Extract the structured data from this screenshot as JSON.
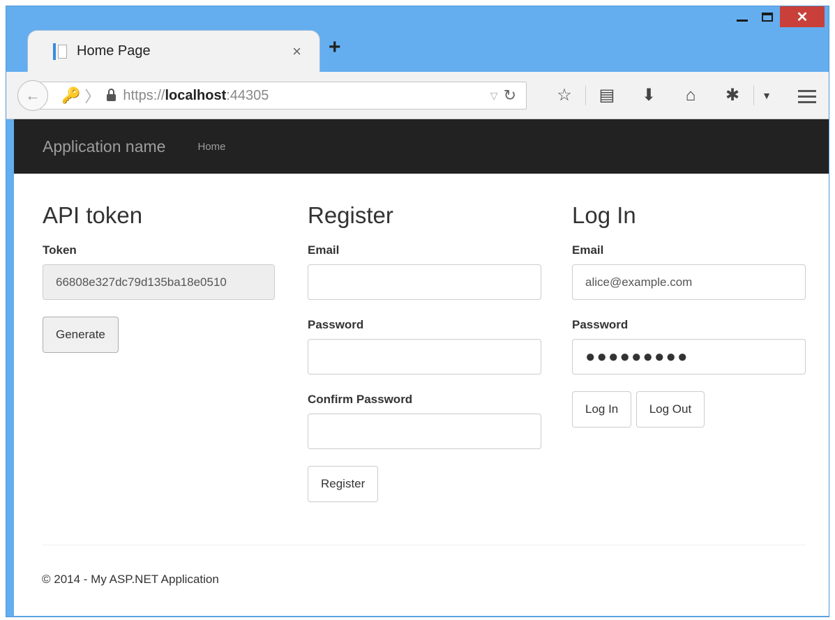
{
  "browser": {
    "tab_title": "Home Page",
    "tab_close": "×",
    "new_tab": "+",
    "url_prefix": "https://",
    "url_host": "localhost",
    "url_port": ":44305"
  },
  "navbar": {
    "brand": "Application name",
    "link_home": "Home"
  },
  "api_token": {
    "heading": "API token",
    "token_label": "Token",
    "token_value": "66808e327dc79d135ba18e0510",
    "generate_button": "Generate"
  },
  "register": {
    "heading": "Register",
    "email_label": "Email",
    "email_value": "",
    "password_label": "Password",
    "password_value": "",
    "confirm_label": "Confirm Password",
    "confirm_value": "",
    "register_button": "Register"
  },
  "login": {
    "heading": "Log In",
    "email_label": "Email",
    "email_value": "alice@example.com",
    "password_label": "Password",
    "password_value": "●●●●●●●●●",
    "login_button": "Log In",
    "logout_button": "Log Out"
  },
  "footer": {
    "text": "© 2014 - My ASP.NET Application"
  }
}
